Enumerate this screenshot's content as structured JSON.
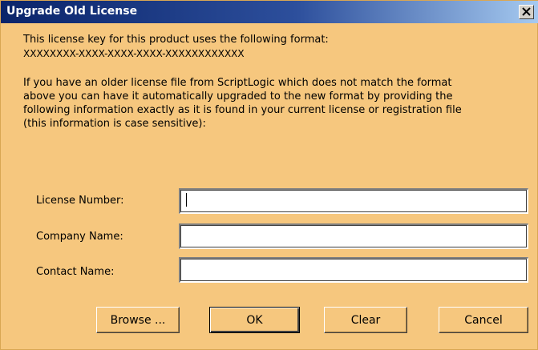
{
  "dialog": {
    "title": "Upgrade Old License",
    "close_glyph": "×"
  },
  "text": {
    "intro_line1": "This license key for this product uses the following format:",
    "intro_line2": "XXXXXXXX-XXXX-XXXX-XXXX-XXXXXXXXXXXX",
    "para_line1": "If you have an older license file from ScriptLogic which does not match the format",
    "para_line2": "above you can have it automatically upgraded to the new format by providing the",
    "para_line3": "following information exactly as it is found in your current license or registration file",
    "para_line4": "(this information is case sensitive):"
  },
  "fields": {
    "license_label": "License Number:",
    "license_value": "",
    "company_label": "Company Name:",
    "company_value": "",
    "contact_label": "Contact Name:",
    "contact_value": ""
  },
  "buttons": {
    "browse": "Browse ...",
    "ok": "OK",
    "clear": "Clear",
    "cancel": "Cancel"
  },
  "colors": {
    "dialog_background": "#f6c77e",
    "title_bar_start": "#0a246a",
    "title_bar_end": "#a6caf0",
    "title_text": "#ffffff"
  },
  "icons": {
    "close": "close-icon"
  }
}
